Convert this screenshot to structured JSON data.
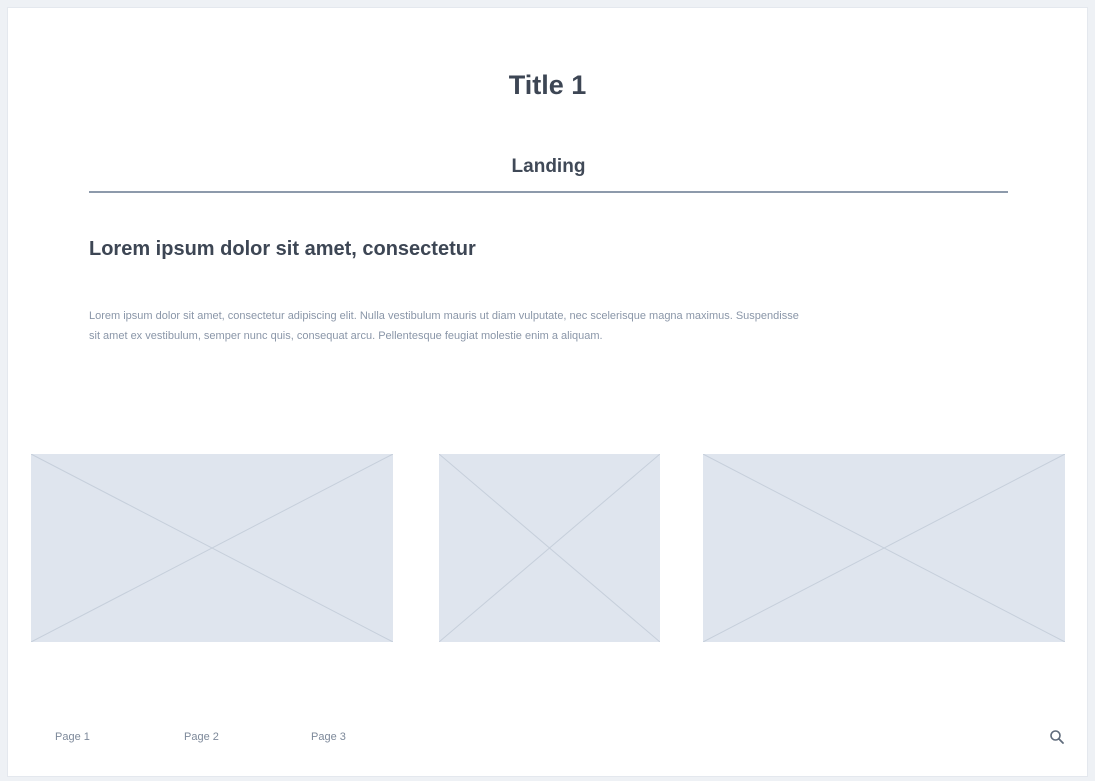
{
  "header": {
    "title": "Title 1"
  },
  "subnav": {
    "active_label": "Landing"
  },
  "content": {
    "heading": "Lorem ipsum dolor sit amet, consectetur",
    "paragraph": "Lorem ipsum dolor sit amet, consectetur adipiscing elit. Nulla vestibulum mauris ut diam vulputate, nec scelerisque magna maximus. Suspendisse sit amet ex vestibulum, semper nunc quis, consequat arcu. Pellentesque feugiat molestie enim a aliquam."
  },
  "image_placeholders": {
    "count": 3,
    "fill_color": "#dfe5ee",
    "line_color": "#c6cfdb"
  },
  "footer": {
    "links": [
      {
        "label": "Page 1"
      },
      {
        "label": "Page 2"
      },
      {
        "label": "Page 3"
      }
    ],
    "search_icon": "search-icon"
  },
  "colors": {
    "background": "#eef1f5",
    "card": "#ffffff",
    "title_text": "#3d4654",
    "body_text": "#8a96a8",
    "divider": "#8d9aab"
  }
}
